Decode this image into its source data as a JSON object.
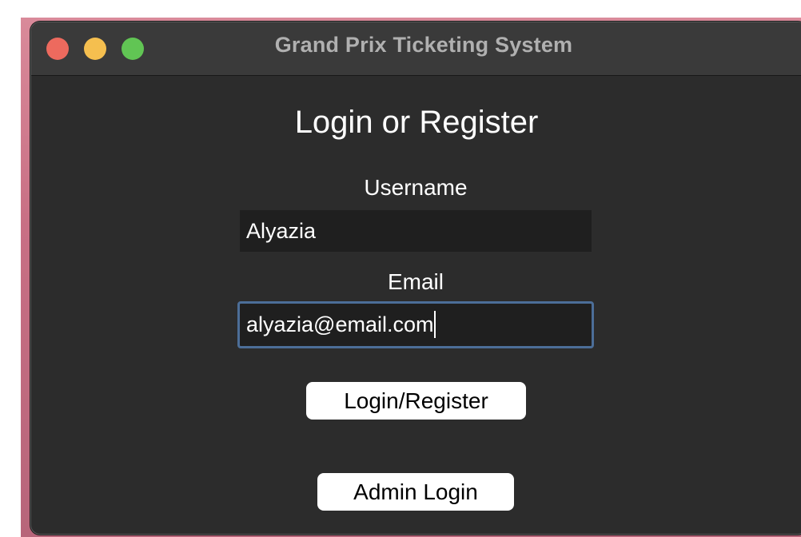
{
  "window": {
    "title": "Grand Prix Ticketing System"
  },
  "form": {
    "heading": "Login or Register",
    "username_label": "Username",
    "username_value": "Alyazia",
    "email_label": "Email",
    "email_value": "alyazia@email.com",
    "login_register_button": "Login/Register",
    "admin_login_button": "Admin Login"
  },
  "colors": {
    "window_background": "#2c2c2c",
    "titlebar_background": "#3a3a3a",
    "input_background": "#1f1f1f",
    "focus_ring": "#4c6e98",
    "close_button": "#ed6a5e",
    "minimize_button": "#f5bf4f",
    "maximize_button": "#61c554",
    "button_background": "#ffffff"
  }
}
